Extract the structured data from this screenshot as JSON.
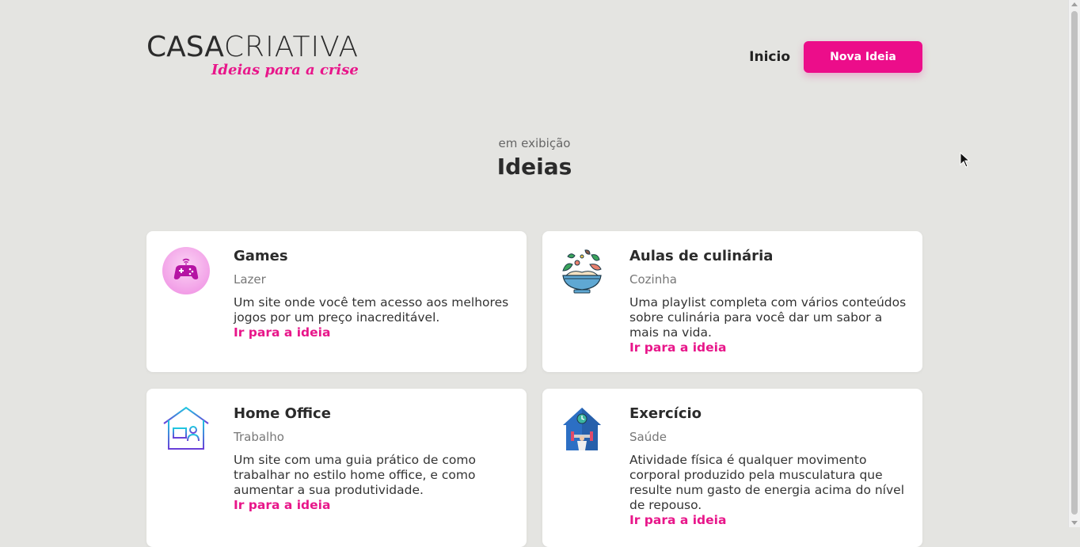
{
  "header": {
    "logo_main_bold": "CASA",
    "logo_main_light": "CRIATIVA",
    "logo_tagline": "Ideias para a crise",
    "nav_home": "Inicio",
    "new_idea_button": "Nova Ideia"
  },
  "section": {
    "subtitle": "em exibição",
    "title": "Ideias"
  },
  "ideas": [
    {
      "title": "Games",
      "category": "Lazer",
      "description": "Um site onde você tem acesso aos melhores jogos por um preço inacreditável.",
      "link": "Ir para a ideia",
      "icon": "gamepad-icon"
    },
    {
      "title": "Aulas de culinária",
      "category": "Cozinha",
      "description": "Uma playlist completa com vários conteúdos sobre culinária para você dar um sabor a mais na vida.",
      "link": "Ir para a ideia",
      "icon": "salad-bowl-icon"
    },
    {
      "title": "Home Office",
      "category": "Trabalho",
      "description": "Um site com uma guia prático de como trabalhar no estilo home office, e como aumentar a sua produtividade.",
      "link": "Ir para a ideia",
      "icon": "home-office-icon"
    },
    {
      "title": "Exercício",
      "category": "Saúde",
      "description": "Atividade física é qualquer movimento corporal produzido pela musculatura que resulte num gasto de energia acima do nível de repouso.",
      "link": "Ir para a ideia",
      "icon": "home-workout-icon"
    }
  ],
  "colors": {
    "accent": "#ec0d8a",
    "background": "#e4e4e1",
    "card": "#ffffff"
  }
}
